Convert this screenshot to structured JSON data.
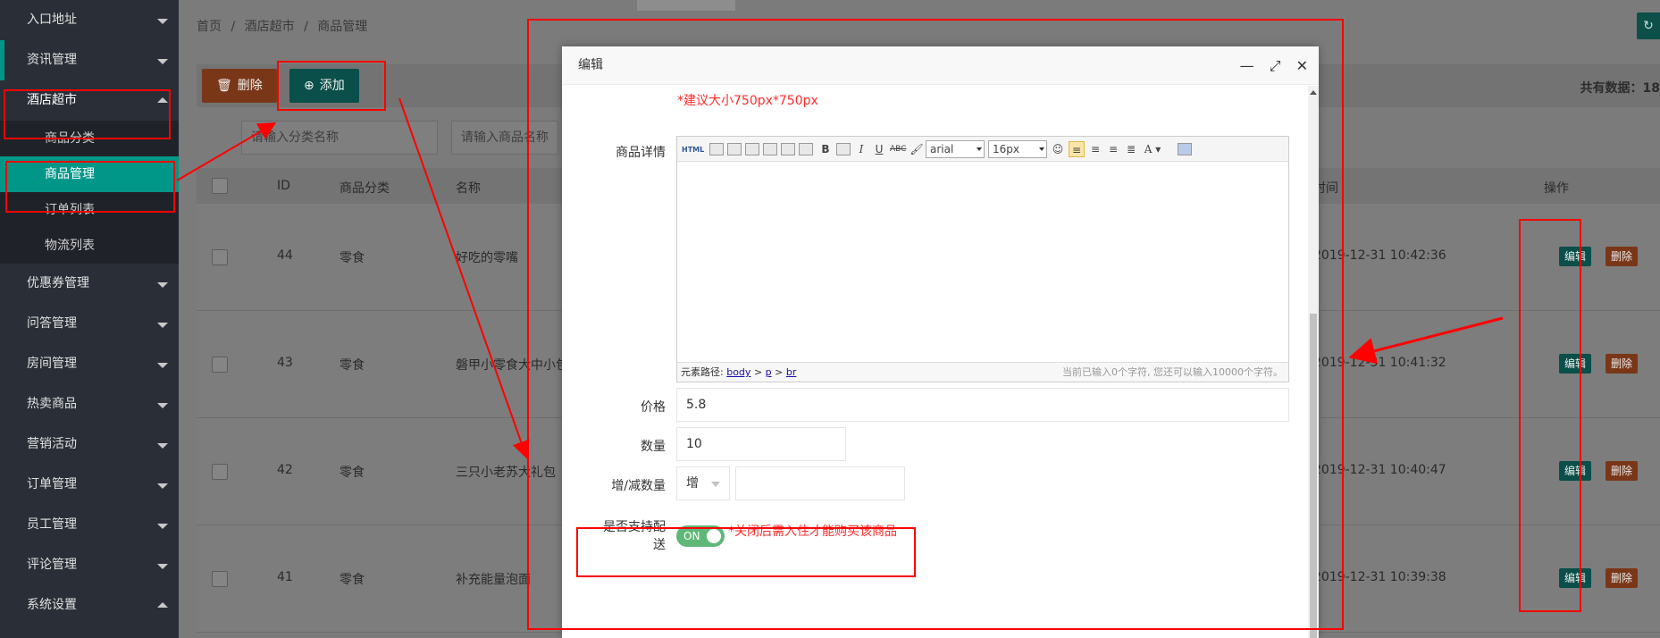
{
  "sidebar": {
    "items": [
      {
        "label": "入口地址"
      },
      {
        "label": "资讯管理"
      },
      {
        "label": "酒店超市"
      },
      {
        "label": "优惠券管理"
      },
      {
        "label": "问答管理"
      },
      {
        "label": "房间管理"
      },
      {
        "label": "热卖商品"
      },
      {
        "label": "营销活动"
      },
      {
        "label": "订单管理"
      },
      {
        "label": "员工管理"
      },
      {
        "label": "评论管理"
      },
      {
        "label": "系统设置"
      }
    ],
    "sub_items": [
      {
        "label": "商品分类"
      },
      {
        "label": "商品管理"
      },
      {
        "label": "订单列表"
      },
      {
        "label": "物流列表"
      }
    ]
  },
  "breadcrumb": [
    "首页",
    "/",
    "酒店超市",
    "/",
    "商品管理"
  ],
  "toolbar": {
    "delete_label": "删除",
    "add_label": "添加",
    "total_label": "共有数据：18"
  },
  "search": {
    "category_placeholder": "请输入分类名称",
    "name_placeholder": "请输入商品名称"
  },
  "table": {
    "headers": {
      "id": "ID",
      "category": "商品分类",
      "name": "名称",
      "time": "时间",
      "ops": "操作"
    },
    "rows": [
      {
        "id": "44",
        "category": "零食",
        "name": "好吃的零嘴",
        "time": "2019-12-31 10:42:36"
      },
      {
        "id": "43",
        "category": "零食",
        "name": "磐甲小零食大中小包",
        "time": "2019-12-31 10:41:32"
      },
      {
        "id": "42",
        "category": "零食",
        "name": "三只小老苏大礼包",
        "time": "2019-12-31 10:40:47"
      },
      {
        "id": "41",
        "category": "零食",
        "name": "补充能量泡面",
        "time": "2019-12-31 10:39:38"
      }
    ],
    "edit_label": "编辑",
    "delete_label": "删除"
  },
  "modal": {
    "title": "编辑",
    "size_hint": "*建议大小750px*750px",
    "detail_label": "商品详情",
    "editor": {
      "html_label": "HTML",
      "font": "arial",
      "size": "16px",
      "path_label": "元素路径:",
      "path_body": "body",
      "path_sep1": ">",
      "path_p": "p",
      "path_sep2": ">",
      "path_br": "br",
      "count": "当前已输入0个字符, 您还可以输入10000个字符。"
    },
    "price_label": "价格",
    "price_value": "5.8",
    "qty_label": "数量",
    "qty_value": "10",
    "adjust_label": "增/减数量",
    "adjust_select": "增",
    "delivery_label": "是否支持配送",
    "switch_label": "ON",
    "delivery_hint": "*关闭后需入住才能购买该商品"
  }
}
